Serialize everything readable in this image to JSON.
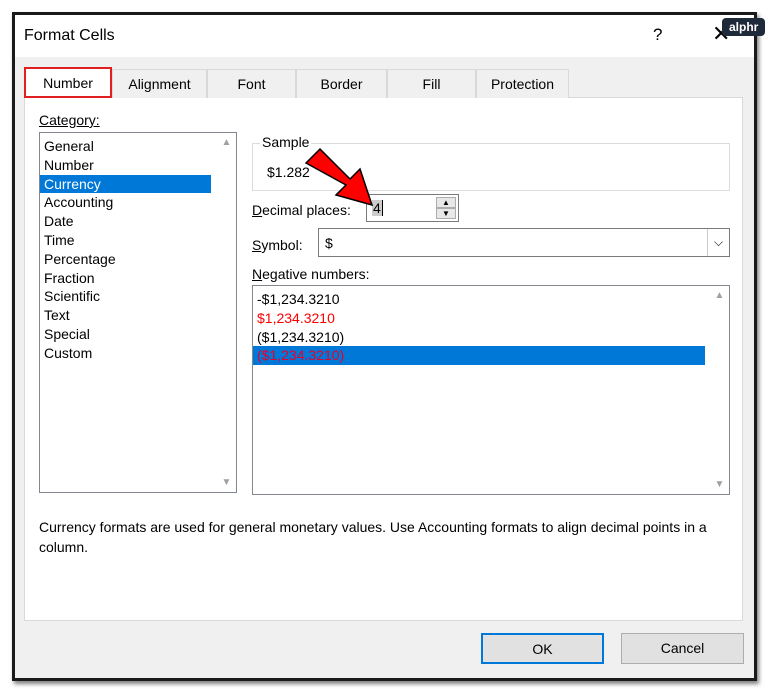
{
  "window": {
    "title": "Format Cells",
    "help_label": "?",
    "close_label": "✕",
    "watermark": "alphr"
  },
  "tabs": [
    "Number",
    "Alignment",
    "Font",
    "Border",
    "Fill",
    "Protection"
  ],
  "category": {
    "label": "Category:",
    "items": [
      "General",
      "Number",
      "Currency",
      "Accounting",
      "Date",
      "Time",
      "Percentage",
      "Fraction",
      "Scientific",
      "Text",
      "Special",
      "Custom"
    ],
    "selected": "Currency"
  },
  "sample": {
    "label": "Sample",
    "value": "$1.282"
  },
  "decimal_places": {
    "label": "Decimal places:",
    "value": "4"
  },
  "symbol": {
    "label": "Symbol:",
    "value": "$"
  },
  "negative_numbers": {
    "label": "Negative numbers:",
    "items": [
      {
        "text": "-$1,234.3210",
        "color": "#000000"
      },
      {
        "text": "$1,234.3210",
        "color": "#ff0000"
      },
      {
        "text": "($1,234.3210)",
        "color": "#000000"
      },
      {
        "text": "($1,234.3210)",
        "color": "#ff0000"
      }
    ],
    "selected_index": 3
  },
  "description": "Currency formats are used for general monetary values.  Use Accounting formats to align decimal points in a column.",
  "buttons": {
    "ok": "OK",
    "cancel": "Cancel"
  },
  "colors": {
    "accent": "#0078d7",
    "highlight_border": "#e02020",
    "arrow": "#ff0000"
  }
}
